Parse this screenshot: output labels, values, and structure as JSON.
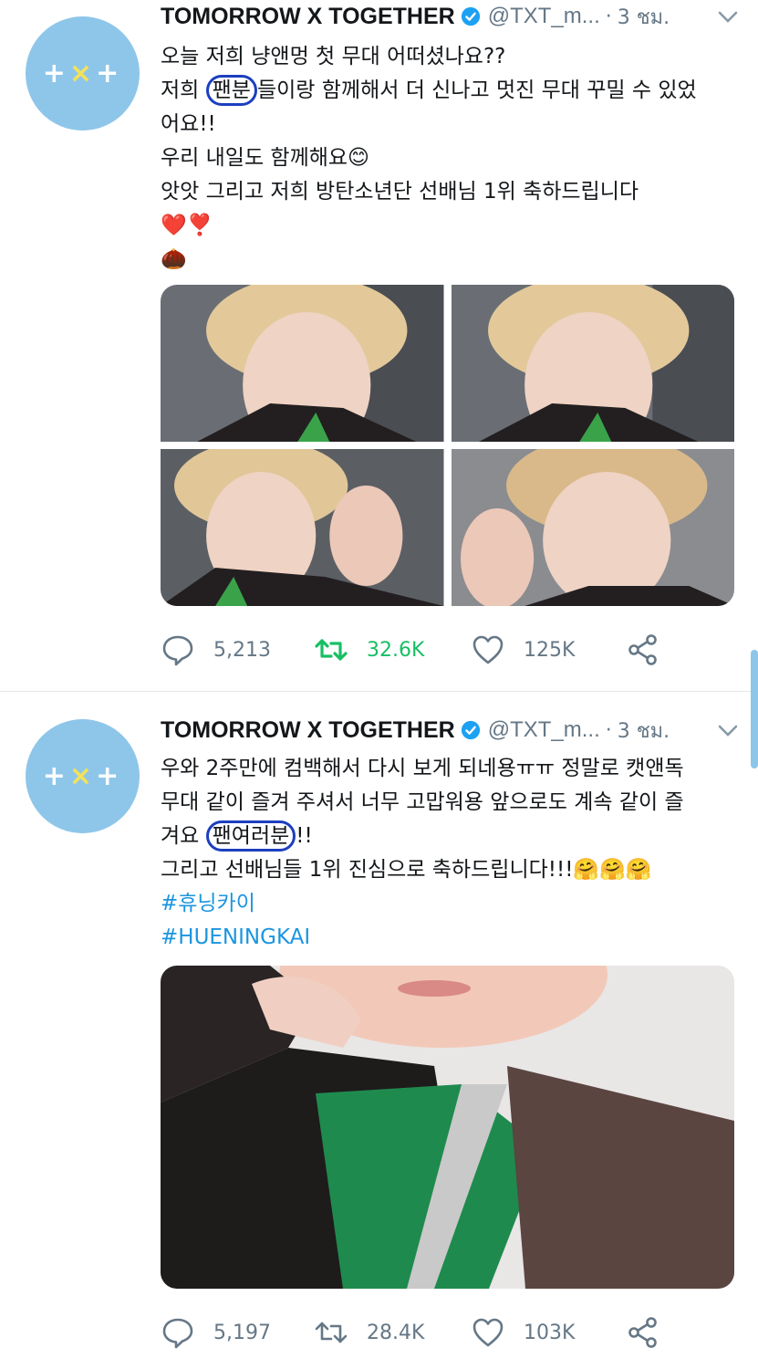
{
  "tweets": [
    {
      "author_name": "TOMORROW X TOGETHER",
      "handle": "@TXT_m...",
      "separator": "·",
      "time": "3 ชม.",
      "avatar_text": "+×+",
      "text_lines": [
        "오늘 저희 냥앤멍 첫 무대 어떠셨나요??",
        "저희 [팬분]들이랑 함께해서 더 신나고 멋진 무대 꾸밀 수 있었",
        "어요!!",
        "우리 내일도 함께해요😊",
        "앗앗 그리고 저희 방탄소년단 선배님 1위 축하드립니다",
        "❤️❣️",
        "🌰"
      ],
      "circled_word": "팬분",
      "reply_count": "5,213",
      "retweet_count": "32.6K",
      "like_count": "125K"
    },
    {
      "author_name": "TOMORROW X TOGETHER",
      "handle": "@TXT_m...",
      "separator": "·",
      "time": "3 ชม.",
      "avatar_text": "+×+",
      "text_lines": [
        "우와 2주만에 컴백해서 다시 보게 되네용ㅠㅠ 정말로 캣앤독",
        "무대 같이 즐겨 주셔서 너무 고맙워용 앞으로도 계속 같이 즐",
        "겨요 [팬여러분]!!",
        "그리고 선배님들 1위 진심으로 축하드립니다!!!🤗🤗🤗"
      ],
      "circled_word": "팬여러분",
      "hashtags": [
        "#휴닝카이",
        "#HUENINGKAI"
      ],
      "reply_count": "5,197",
      "retweet_count": "28.4K",
      "like_count": "103K"
    }
  ],
  "colors": {
    "avatar_bg": "#8ec6ea",
    "verified": "#1da1f2",
    "retweet_active": "#17bf63",
    "hashtag": "#1b95e0",
    "annotation_circle": "#1c3fc0"
  }
}
